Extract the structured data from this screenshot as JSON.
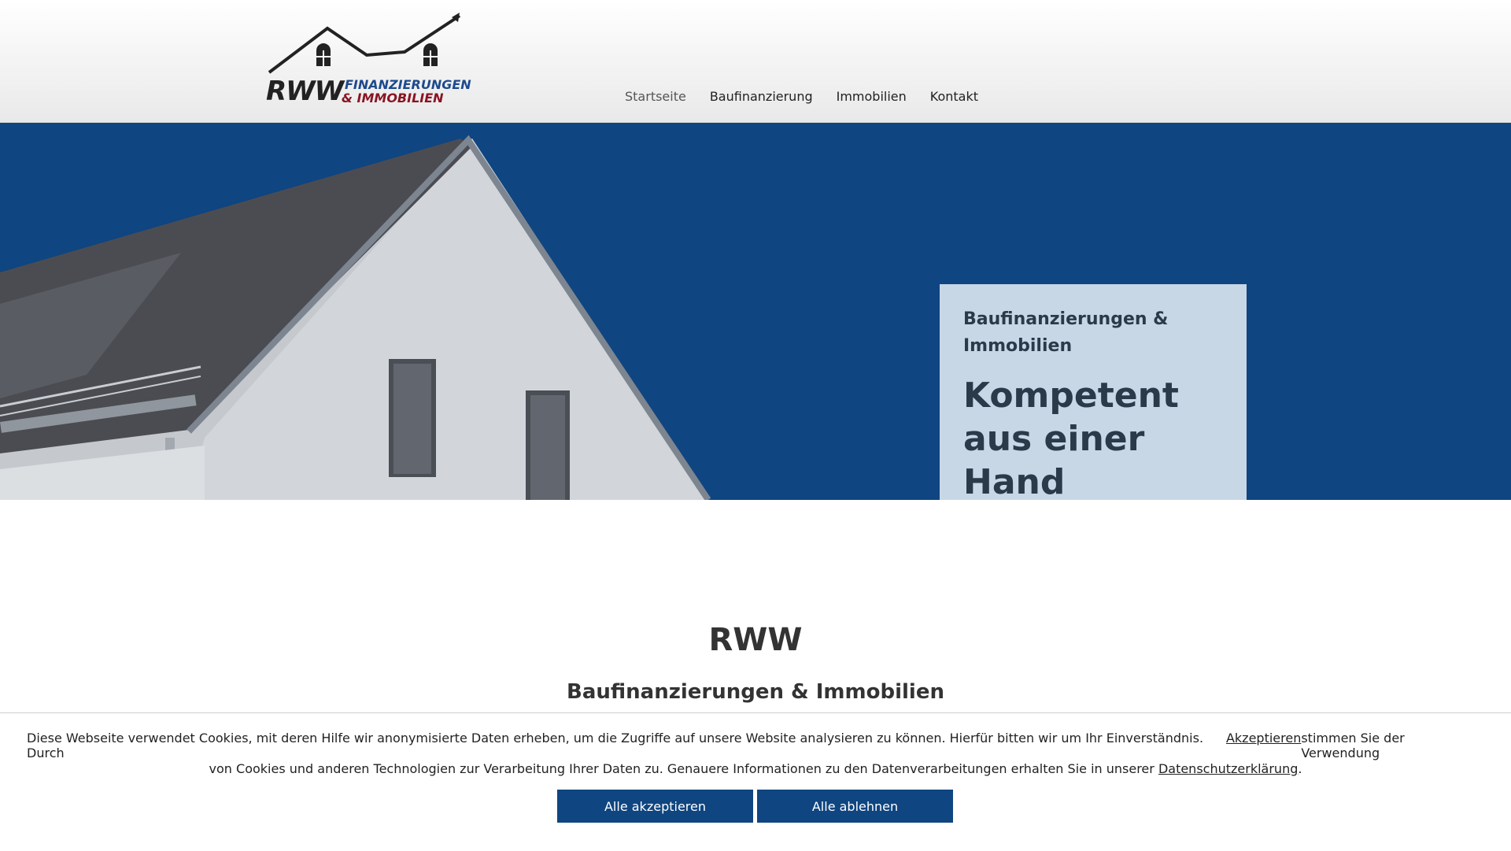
{
  "logo": {
    "line1": "RWW",
    "line2": "FINANZIERUNGEN",
    "line3": "& IMMOBILIEN"
  },
  "nav": {
    "items": [
      {
        "label": "Startseite",
        "active": true
      },
      {
        "label": "Baufinanzierung",
        "active": false
      },
      {
        "label": "Immobilien",
        "active": false
      },
      {
        "label": "Kontakt",
        "active": false
      }
    ]
  },
  "hero": {
    "subtitle": "Baufinanzierungen & Immobilien",
    "title": "Kompetent aus einer Hand"
  },
  "main": {
    "title": "RWW",
    "subtitle": "Baufinanzierungen & Immobilien"
  },
  "cookie": {
    "text_part1": "Diese Webseite verwendet Cookies, mit deren Hilfe wir anonymisierte Daten erheben, um die Zugriffe auf unsere Website analysieren zu können. Hierfür bitten wir um Ihr Einverständnis. Durch",
    "accept_link": "Akzeptieren",
    "text_part2": "stimmen Sie der Verwendung",
    "text_part3": "von Cookies und anderen Technologien zur Verarbeitung Ihrer Daten zu. Genauere Informationen zu den Datenverarbeitungen erhalten Sie in unserer",
    "privacy_link": "Datenschutzerklärung",
    "text_end": ".",
    "accept_all": "Alle akzeptieren",
    "decline_all": "Alle ablehnen"
  },
  "colors": {
    "brand_blue": "#0f4580",
    "brand_red": "#8a1424",
    "card_bg": "#c8d7e6"
  }
}
